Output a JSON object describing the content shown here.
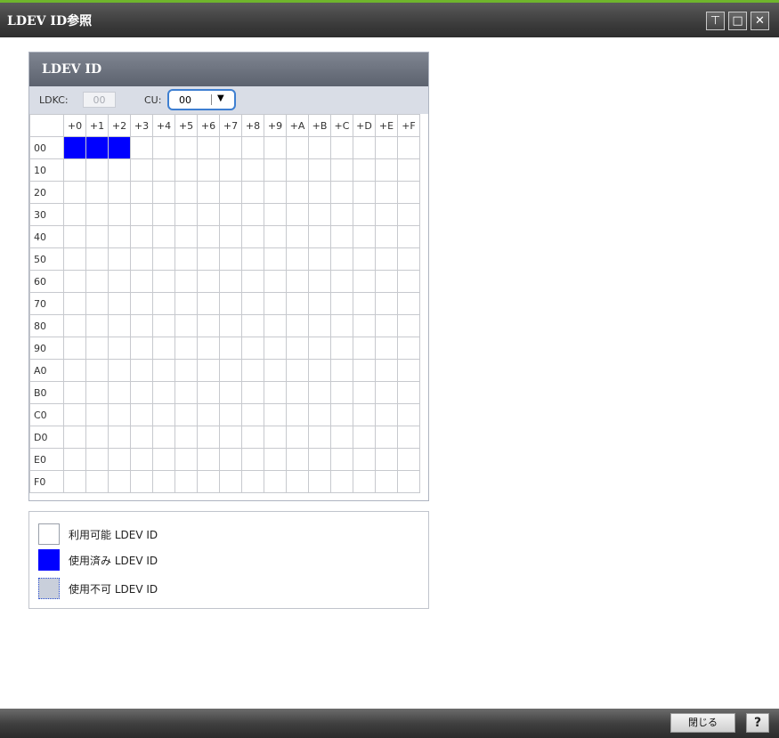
{
  "window": {
    "title": "LDEV ID参照",
    "buttons": {
      "pin": "⊤",
      "maximize": "□",
      "close": "✕"
    }
  },
  "panel": {
    "title": "LDEV ID",
    "ldkc_label": "LDKC:",
    "ldkc_value": "00",
    "cu_label": "CU:",
    "cu_value": "00",
    "cu_arrow": "▼"
  },
  "grid": {
    "columns": [
      "+0",
      "+1",
      "+2",
      "+3",
      "+4",
      "+5",
      "+6",
      "+7",
      "+8",
      "+9",
      "+A",
      "+B",
      "+C",
      "+D",
      "+E",
      "+F"
    ],
    "rows": [
      "00",
      "10",
      "20",
      "30",
      "40",
      "50",
      "60",
      "70",
      "80",
      "90",
      "A0",
      "B0",
      "C0",
      "D0",
      "E0",
      "F0"
    ],
    "used_cells": [
      [
        0,
        0
      ],
      [
        0,
        1
      ],
      [
        0,
        2
      ]
    ]
  },
  "legend": {
    "available": "利用可能 LDEV ID",
    "used": "使用済み LDEV ID",
    "unavailable": "使用不可 LDEV ID"
  },
  "footer": {
    "close_label": "閉じる",
    "help_label": "?"
  },
  "colors": {
    "used": "#0000ff",
    "unavailable": "#c9cfdb",
    "accent": "#6fb52c"
  }
}
